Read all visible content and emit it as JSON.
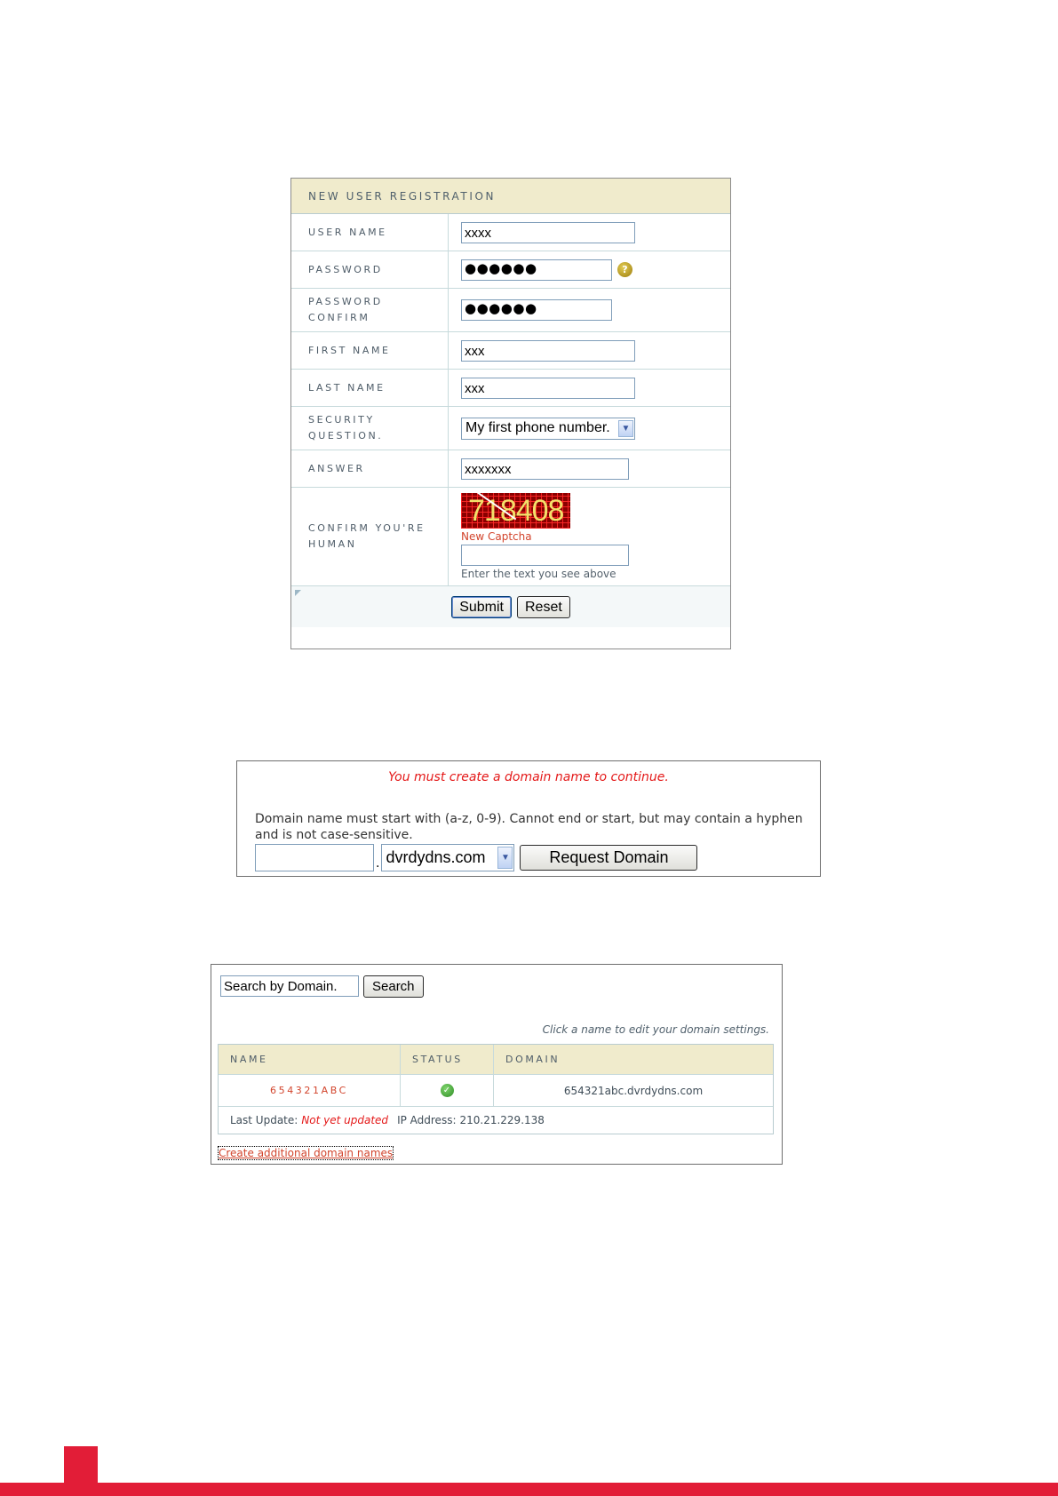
{
  "registration": {
    "title": "NEW USER REGISTRATION",
    "fields": {
      "username": {
        "label": "USER NAME",
        "value": "xxxx"
      },
      "password": {
        "label": "PASSWORD",
        "value": "●●●●●●",
        "help_icon": "question-circle-icon"
      },
      "password_confirm": {
        "label1": "PASSWORD",
        "label2": "CONFIRM",
        "value": "●●●●●●"
      },
      "first_name": {
        "label": "FIRST NAME",
        "value": "xxx"
      },
      "last_name": {
        "label": "LAST NAME",
        "value": "xxx"
      },
      "security_question": {
        "label1": "SECURITY",
        "label2": "QUESTION.",
        "selected": "My first phone number."
      },
      "answer": {
        "label": "ANSWER",
        "value": "xxxxxxx"
      },
      "captcha": {
        "label1": "CONFIRM YOU'RE",
        "label2": "HUMAN",
        "captcha_text": "718408",
        "new_captcha_link": "New Captcha",
        "input_value": "",
        "hint": "Enter the text you see above"
      }
    },
    "submit_label": "Submit",
    "reset_label": "Reset"
  },
  "domain_request": {
    "error_message": "You must create a domain name to continue.",
    "rules": "Domain name must start with (a-z, 0-9). Cannot end or start, but may contain a hyphen and is not case-sensitive.",
    "name_value": "",
    "separator": ".",
    "domain_selected": "dvrdydns.com",
    "request_label": "Request Domain"
  },
  "domain_list": {
    "search_value": "Search by Domain.",
    "search_label": "Search",
    "click_hint": "Click a name to edit your domain settings.",
    "columns": [
      "NAME",
      "STATUS",
      "DOMAIN"
    ],
    "rows": [
      {
        "name": "654321ABC",
        "status_icon": "check-circle-icon",
        "domain": "654321abc.dvrdydns.com"
      }
    ],
    "last_update_label": "Last Update:",
    "last_update_value": "Not yet updated",
    "ip_label": "IP Address:",
    "ip_value": "210.21.229.138",
    "add_link": "Create additional domain names"
  },
  "colors": {
    "accent_red": "#e21d37",
    "header_beige": "#f0ebcc",
    "link_orange": "#d2442c",
    "error_red": "#e41818"
  }
}
